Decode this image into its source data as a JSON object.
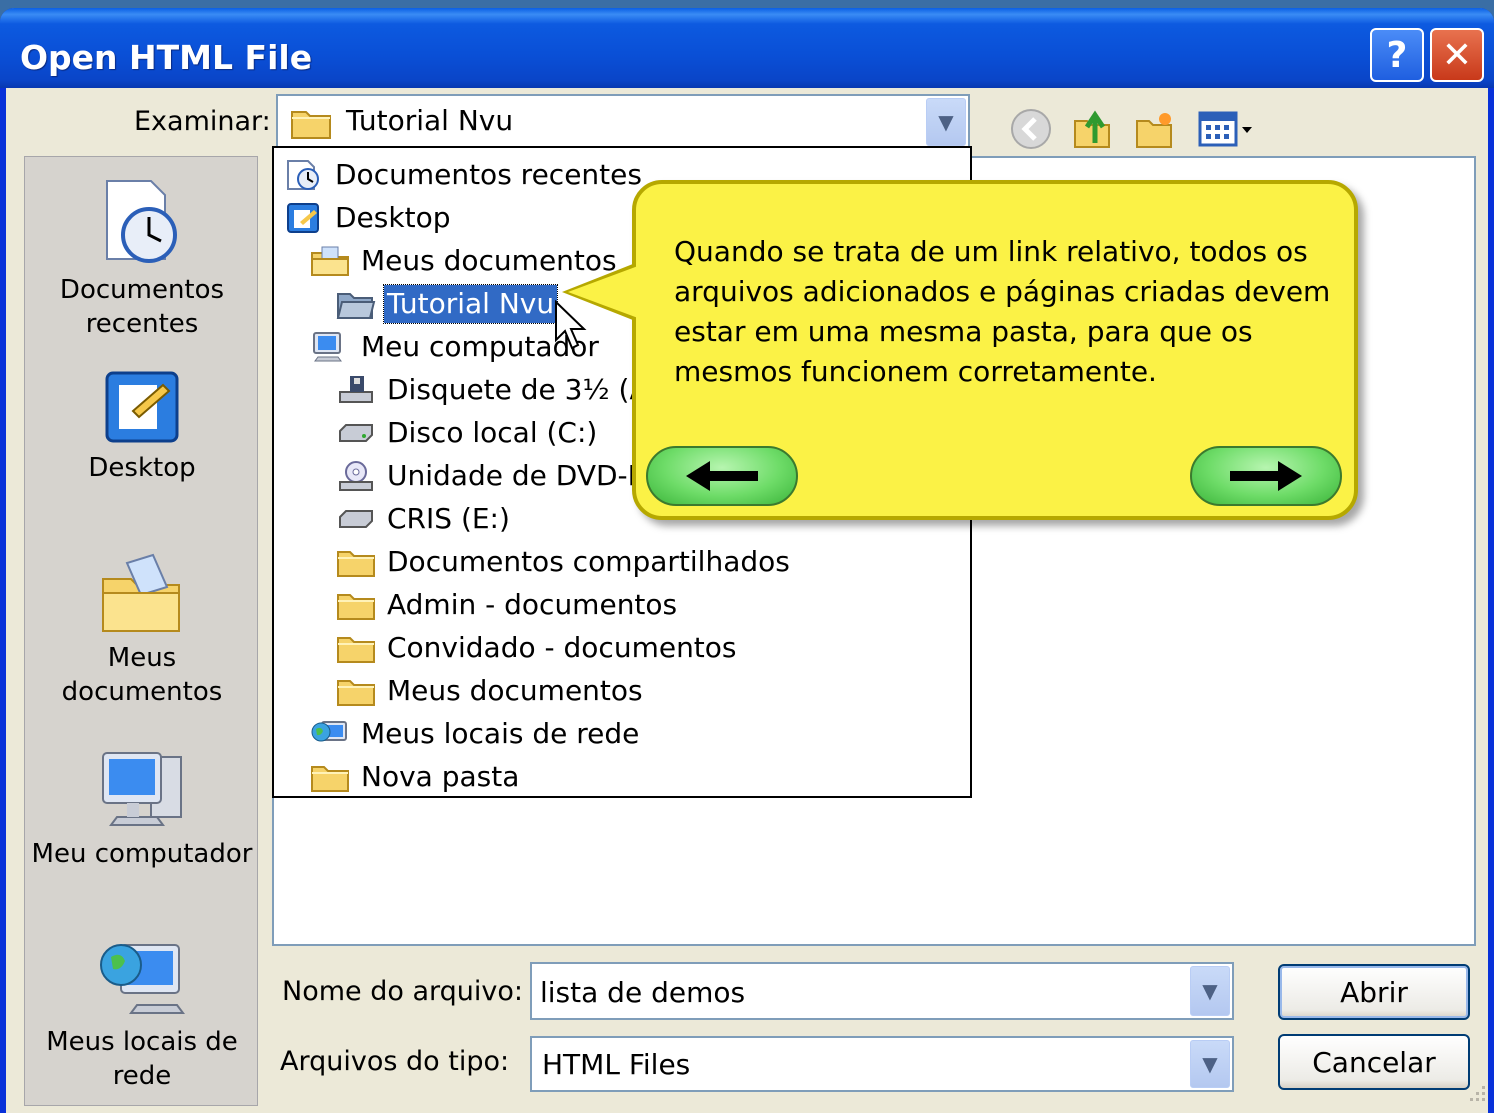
{
  "window": {
    "title": "Open HTML File",
    "help_label": "?",
    "close_label": "✕"
  },
  "lookin": {
    "label": "Examinar:",
    "value": "Tutorial Nvu"
  },
  "toolbar": {
    "back_icon": "back-icon",
    "up_icon": "up-folder-icon",
    "new_folder_icon": "new-folder-icon",
    "views_icon": "views-menu-icon"
  },
  "places": [
    {
      "label": "Documentos recentes",
      "icon": "recent-documents-icon"
    },
    {
      "label": "Desktop",
      "icon": "desktop-icon"
    },
    {
      "label": "Meus documentos",
      "icon": "my-documents-icon"
    },
    {
      "label": "Meu computador",
      "icon": "my-computer-icon"
    },
    {
      "label": "Meus locais de rede",
      "icon": "network-places-icon"
    }
  ],
  "dropdown": {
    "items": [
      {
        "label": "Documentos recentes",
        "icon": "recent-documents-icon",
        "level": 0
      },
      {
        "label": "Desktop",
        "icon": "desktop-icon",
        "level": 0
      },
      {
        "label": "Meus documentos",
        "icon": "my-documents-icon",
        "level": 1
      },
      {
        "label": "Tutorial Nvu",
        "icon": "folder-open-icon",
        "level": 2,
        "selected": true
      },
      {
        "label": "Meu computador",
        "icon": "my-computer-icon",
        "level": 1
      },
      {
        "label": "Disquete de 3½ (A:)",
        "icon": "floppy-drive-icon",
        "level": 2
      },
      {
        "label": "Disco local (C:)",
        "icon": "hard-drive-icon",
        "level": 2
      },
      {
        "label": "Unidade de DVD-RW (D:)",
        "icon": "dvd-drive-icon",
        "level": 2
      },
      {
        "label": "CRIS (E:)",
        "icon": "removable-drive-icon",
        "level": 2
      },
      {
        "label": "Documentos compartilhados",
        "icon": "folder-icon",
        "level": 2
      },
      {
        "label": "Admin - documentos",
        "icon": "folder-icon",
        "level": 2
      },
      {
        "label": "Convidado - documentos",
        "icon": "folder-icon",
        "level": 2
      },
      {
        "label": "Meus documentos",
        "icon": "folder-icon",
        "level": 2
      },
      {
        "label": "Meus locais de rede",
        "icon": "network-places-icon",
        "level": 1
      },
      {
        "label": "Nova pasta",
        "icon": "folder-icon",
        "level": 1
      }
    ]
  },
  "callout": {
    "text": "Quando se trata de um link relativo, todos os arquivos adicionados e páginas criadas devem estar em uma mesma pasta, para que os mesmos funcionem corretamente.",
    "prev_label": "🡐",
    "next_label": "🡒"
  },
  "filename": {
    "label": "Nome do arquivo:",
    "value": "lista de demos"
  },
  "filetype": {
    "label": "Arquivos do tipo:",
    "value": "HTML Files"
  },
  "buttons": {
    "open": "Abrir",
    "cancel": "Cancelar"
  },
  "colors": {
    "title_bar": "#0a4fd6",
    "selection": "#316ac5",
    "callout_bg": "#fbf246",
    "nav_button": "#6edc68"
  }
}
